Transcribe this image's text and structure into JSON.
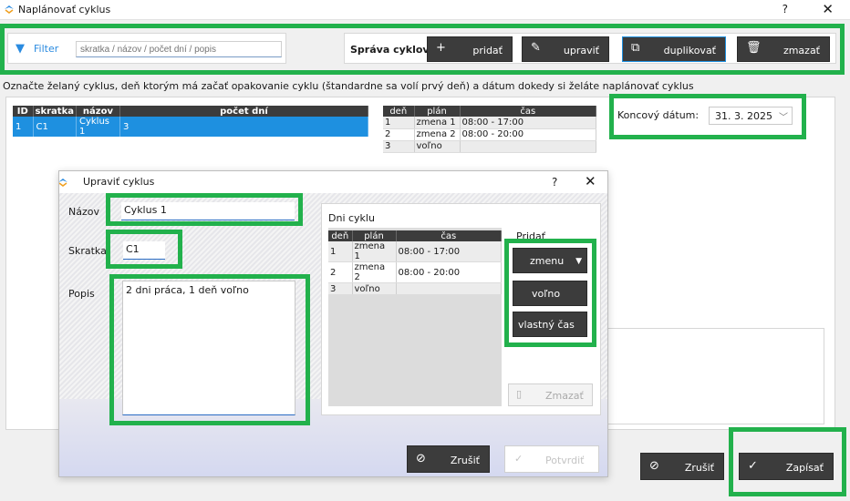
{
  "window": {
    "title": "Naplánovať cyklus",
    "help": "?",
    "close": "✕"
  },
  "toolbar": {
    "filter_label": "Filter",
    "filter_placeholder": "skratka / názov / počet dní / popis",
    "section_label": "Správa cyklov",
    "add_label": "pridať",
    "edit_label": "upraviť",
    "duplicate_label": "duplikovať",
    "delete_label": "zmazať"
  },
  "instruction": "Označte želaný cyklus, deň ktorým má začať opakovanie cyklu (štandardne sa volí prvý deň) a dátum dokedy si želáte naplánovať cyklus",
  "cycles_table": {
    "headers": [
      "ID",
      "skratka",
      "názov",
      "počet dní"
    ],
    "rows": [
      [
        "1",
        "C1",
        "Cyklus 1",
        "3"
      ]
    ]
  },
  "days_table": {
    "headers": [
      "deň",
      "plán",
      "čas"
    ],
    "rows": [
      [
        "1",
        "zmena 1",
        "08:00 - 17:00"
      ],
      [
        "2",
        "zmena 2",
        "08:00 - 20:00"
      ],
      [
        "3",
        "voľno",
        ""
      ]
    ]
  },
  "end_date": {
    "label": "Koncový dátum:",
    "value": "31. 3. 2025"
  },
  "main_buttons": {
    "cancel": "Zrušiť",
    "save": "Zapísať"
  },
  "dialog": {
    "title": "Upraviť cyklus",
    "help": "?",
    "close": "✕",
    "name_label": "Názov",
    "name_value": "Cyklus 1",
    "abbr_label": "Skratka",
    "abbr_value": "C1",
    "desc_label": "Popis",
    "desc_value": "2 dni práca, 1 deň voľno",
    "days_title": "Dni cyklu",
    "add_label": "Pridať",
    "shift_button": "zmenu",
    "free_button": "voľno",
    "custom_button": "vlastný čas",
    "delete_button": "Zmazať",
    "cancel_button": "Zrušiť",
    "confirm_button": "Potvrdiť"
  },
  "colors": {
    "highlight": "#22b14c",
    "accent": "#1e90e0",
    "dark_button": "#3c3c3c"
  }
}
